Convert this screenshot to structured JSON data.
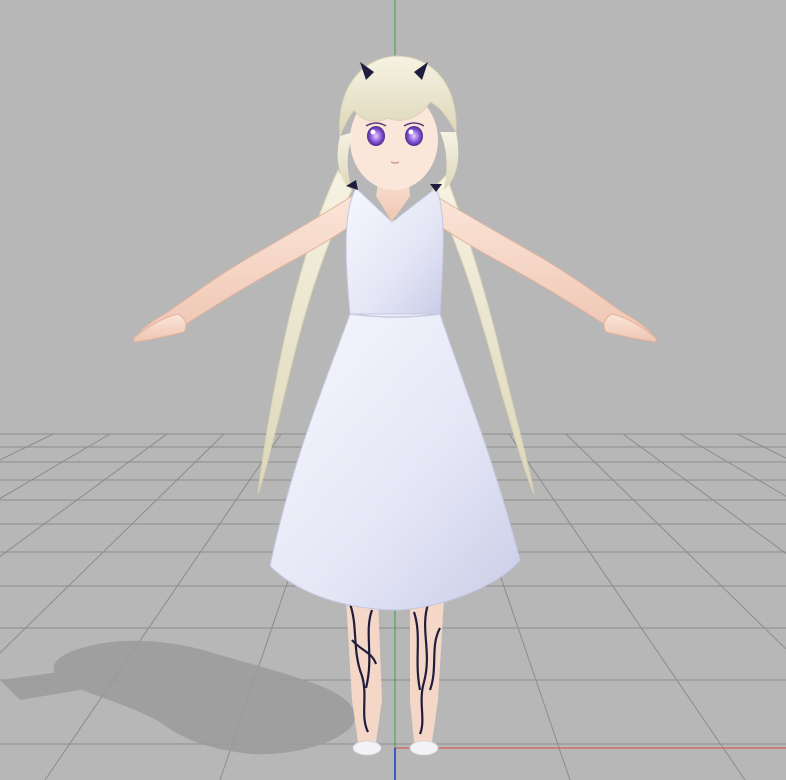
{
  "viewport": {
    "background": "#b7b7b7",
    "grid_color": "#8c8c8c",
    "axis_y_color": "#3fa23f",
    "axis_x_color": "#e24a4a",
    "axis_z_color": "#3a57c8"
  },
  "model": {
    "hair_color": "#f1edd8",
    "hair_shadow": "#dcd6bd",
    "skin_color": "#f8dccd",
    "skin_shadow": "#e9bba6",
    "dress_color": "#eceef9",
    "dress_shadow": "#cfd2ea",
    "eye_color": "#8b58d9",
    "accent_dark": "#1f1d3d",
    "shadow_color": "#9a9a9a"
  },
  "icons": {
    "head_accessory": "horn-bow-icon"
  }
}
